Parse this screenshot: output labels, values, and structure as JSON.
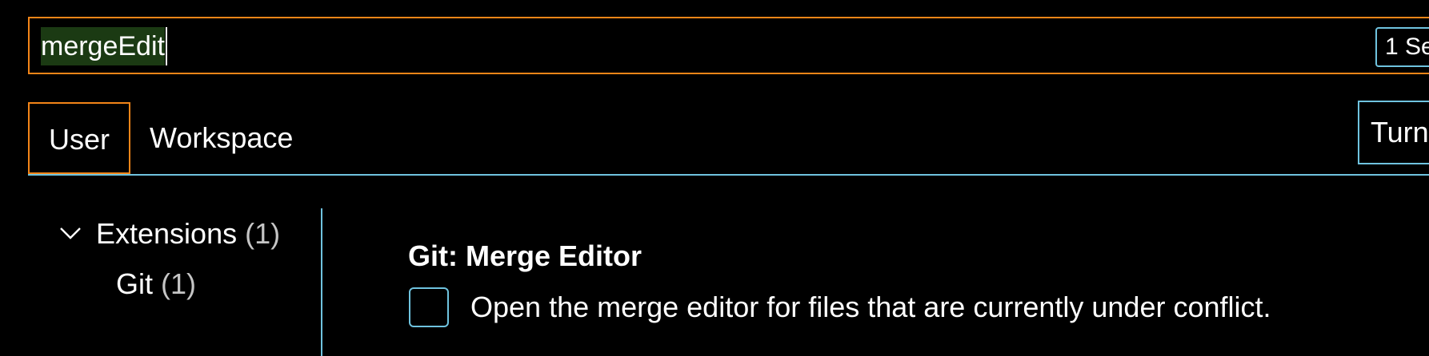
{
  "search": {
    "value": "mergeEdit",
    "result_count": "1 Se"
  },
  "tabs": [
    {
      "label": "User",
      "active": true
    },
    {
      "label": "Workspace",
      "active": false
    }
  ],
  "sync_button": {
    "label": "Turn"
  },
  "tree": {
    "extensions": {
      "label": "Extensions",
      "count": "(1)"
    },
    "git": {
      "label": "Git",
      "count": "(1)"
    }
  },
  "setting": {
    "category": "Git: ",
    "name": "Merge Editor",
    "description": "Open the merge editor for files that are currently under conflict.",
    "checked": false
  },
  "colors": {
    "background": "#000000",
    "focus_border": "#f38518",
    "contrast_border": "#6fc3df",
    "selection": "#1b3a13"
  },
  "icons": {
    "tree_toggle": "chevron-down-icon"
  }
}
